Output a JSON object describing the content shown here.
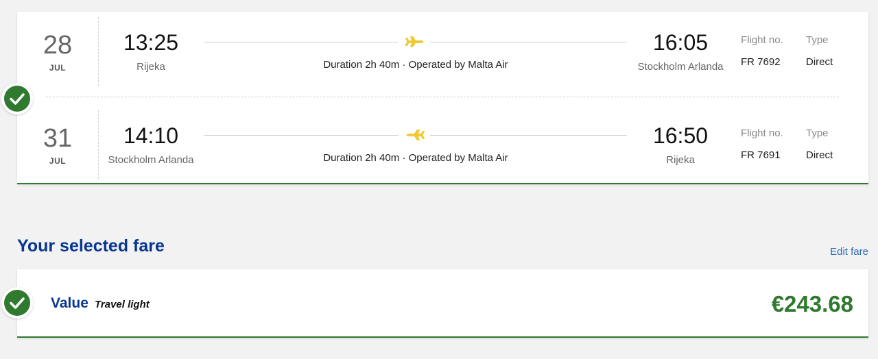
{
  "flights": [
    {
      "day": "28",
      "month": "JUL",
      "dep_time": "13:25",
      "dep_city": "Rijeka",
      "arr_time": "16:05",
      "arr_city": "Stockholm Arlanda",
      "route_info": "Duration 2h 40m · Operated by Malta Air",
      "flight_no_label": "Flight no.",
      "flight_no": "FR 7692",
      "type_label": "Type",
      "type": "Direct",
      "plane_icon": "plane-right-icon"
    },
    {
      "day": "31",
      "month": "JUL",
      "dep_time": "14:10",
      "dep_city": "Stockholm Arlanda",
      "arr_time": "16:50",
      "arr_city": "Rijeka",
      "route_info": "Duration 2h 40m · Operated by Malta Air",
      "flight_no_label": "Flight no.",
      "flight_no": "FR 7691",
      "type_label": "Type",
      "type": "Direct",
      "plane_icon": "plane-left-icon"
    }
  ],
  "fare_section": {
    "title": "Your selected fare",
    "edit_label": "Edit fare"
  },
  "fare": {
    "name": "Value",
    "tagline": "Travel light",
    "price": "€243.68"
  },
  "colors": {
    "brand_blue": "#073590",
    "success_green": "#2f7a2f",
    "plane_yellow": "#f1c933",
    "link_blue": "#2a6ab8"
  }
}
